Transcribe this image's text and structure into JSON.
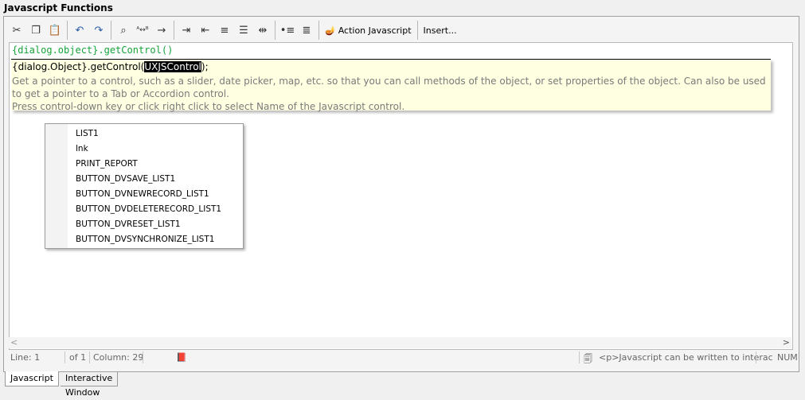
{
  "window": {
    "title": "Javascript Functions"
  },
  "toolbar": {
    "icons": [
      "cut-icon",
      "copy-icon",
      "paste-icon",
      "undo-icon",
      "redo-icon",
      "find-icon",
      "replace-icon",
      "goto-icon",
      "indent-icon",
      "outdent-icon",
      "comment-icon",
      "uncomment-icon",
      "toggle-icon",
      "bullet-list-icon",
      "numbered-list-icon"
    ],
    "action_javascript_label": "Action Javascript",
    "insert_label": "Insert..."
  },
  "editor": {
    "code_line": "{dialog.object}.getControl()",
    "tooltip": {
      "signature_prefix": "{dialog.Object}.getControl(",
      "signature_param": "UXJSControl",
      "signature_suffix": ");",
      "description_line1": "Get a pointer to a control, such as a slider, date picker, map, etc. so that you can call methods of the object, or set properties of the object. Can also be used to get a pointer to a Tab or Accordion control.",
      "description_line2": "Press control-down key or click right click to select Name of the Javascript control."
    },
    "autocomplete": [
      "LIST1",
      "lnk",
      "PRINT_REPORT",
      "BUTTON_DVSAVE_LIST1",
      "BUTTON_DVNEWRECORD_LIST1",
      "BUTTON_DVDELETERECORD_LIST1",
      "BUTTON_DVRESET_LIST1",
      "BUTTON_DVSYNCHRONIZE_LIST1"
    ]
  },
  "scroll": {
    "left_arrow": "<",
    "right_arrow": ">"
  },
  "status": {
    "line": "Line: 1",
    "of": "of 1",
    "column": "Column: 29",
    "hint": "<p>Javascript can be written to interac",
    "num": "NUM"
  },
  "tabs": [
    "Javascript",
    "Interactive Window"
  ],
  "colors": {
    "code": "#16a33a",
    "tooltip_bg": "#ffffe1",
    "highlight_bg": "#000000"
  }
}
